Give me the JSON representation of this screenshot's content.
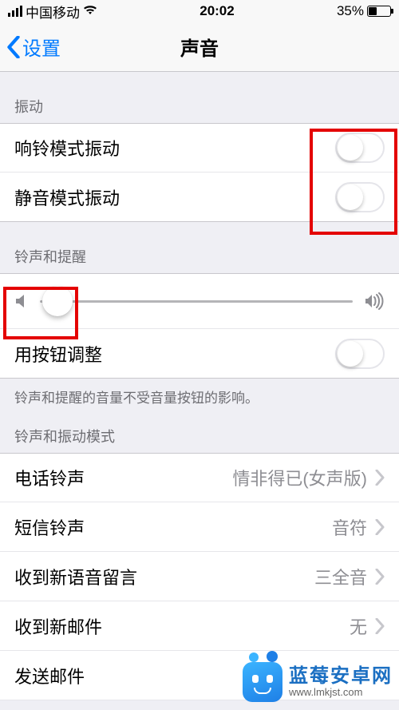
{
  "status_bar": {
    "carrier": "中国移动",
    "time": "20:02",
    "battery_text": "35%"
  },
  "nav": {
    "back": "设置",
    "title": "声音"
  },
  "sections": {
    "vibration_header": "振动",
    "ring_vibrate": "响铃模式振动",
    "silent_vibrate": "静音模式振动",
    "ringer_header": "铃声和提醒",
    "button_adjust": "用按钮调整",
    "ringer_footer": "铃声和提醒的音量不受音量按钮的影响。",
    "pattern_header": "铃声和振动模式"
  },
  "rows": {
    "ringtone": {
      "label": "电话铃声",
      "value": "情非得已(女声版)"
    },
    "text_tone": {
      "label": "短信铃声",
      "value": "音符"
    },
    "new_voicemail": {
      "label": "收到新语音留言",
      "value": "三全音"
    },
    "new_mail": {
      "label": "收到新邮件",
      "value": "无"
    },
    "sent_mail": {
      "label": "发送邮件",
      "value": ""
    }
  },
  "watermark": {
    "title": "蓝莓安卓网",
    "url": "www.lmkjst.com"
  }
}
